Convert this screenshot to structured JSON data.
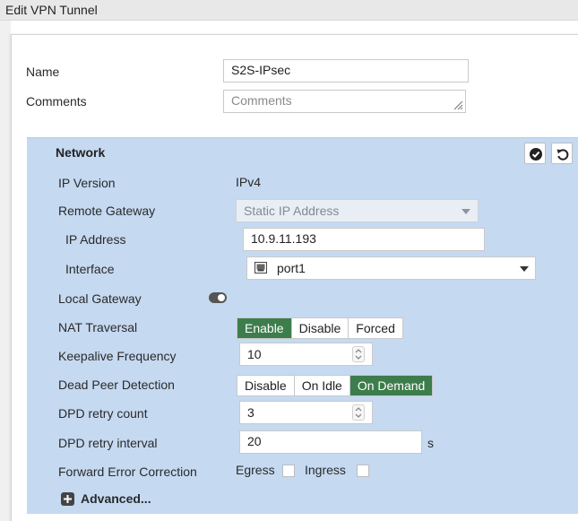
{
  "window": {
    "title": "Edit VPN Tunnel"
  },
  "form": {
    "name": {
      "label": "Name",
      "value": "S2S-IPsec"
    },
    "comments": {
      "label": "Comments",
      "placeholder": "Comments"
    }
  },
  "network": {
    "title": "Network",
    "ip_version": {
      "label": "IP Version",
      "value": "IPv4"
    },
    "remote_gateway": {
      "label": "Remote Gateway",
      "value": "Static IP Address"
    },
    "ip_address": {
      "label": "IP Address",
      "value": "10.9.11.193"
    },
    "interface": {
      "label": "Interface",
      "value": "port1",
      "icon": "network-port-icon"
    },
    "local_gateway": {
      "label": "Local Gateway",
      "enabled": false
    },
    "nat_traversal": {
      "label": "NAT Traversal",
      "options": [
        "Enable",
        "Disable",
        "Forced"
      ],
      "selected": "Enable"
    },
    "keepalive_frequency": {
      "label": "Keepalive Frequency",
      "value": "10"
    },
    "dead_peer_detection": {
      "label": "Dead Peer Detection",
      "options": [
        "Disable",
        "On Idle",
        "On Demand"
      ],
      "selected": "On Demand"
    },
    "dpd_retry_count": {
      "label": "DPD retry count",
      "value": "3"
    },
    "dpd_retry_interval": {
      "label": "DPD retry interval",
      "value": "20",
      "unit": "s"
    },
    "forward_error_correction": {
      "label": "Forward Error Correction",
      "egress": "Egress",
      "ingress": "Ingress"
    },
    "advanced": {
      "label": "Advanced..."
    }
  },
  "colors": {
    "section_bg": "#c5d9f1",
    "active_green": "#3d7d4c"
  }
}
